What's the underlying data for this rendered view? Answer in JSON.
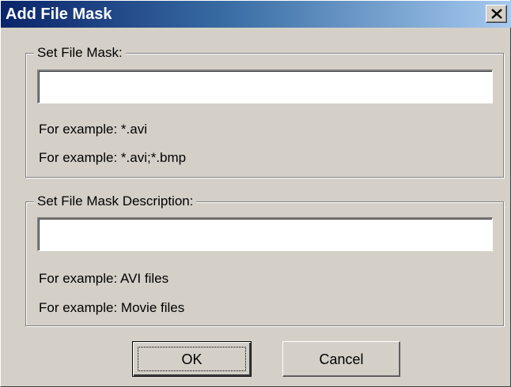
{
  "window": {
    "title": "Add File Mask"
  },
  "mask_group": {
    "legend": "Set File Mask:",
    "input_value": "",
    "hint1": "For example: *.avi",
    "hint2": "For example: *.avi;*.bmp"
  },
  "desc_group": {
    "legend": "Set File Mask Description:",
    "input_value": "",
    "hint1": "For example: AVI files",
    "hint2": "For example: Movie files"
  },
  "buttons": {
    "ok": "OK",
    "cancel": "Cancel"
  },
  "colors": {
    "title_gradient_start": "#0a246a",
    "title_gradient_end": "#a6caf0",
    "dialog_face": "#d4d0c8"
  },
  "icons": {
    "close": "close-icon"
  }
}
